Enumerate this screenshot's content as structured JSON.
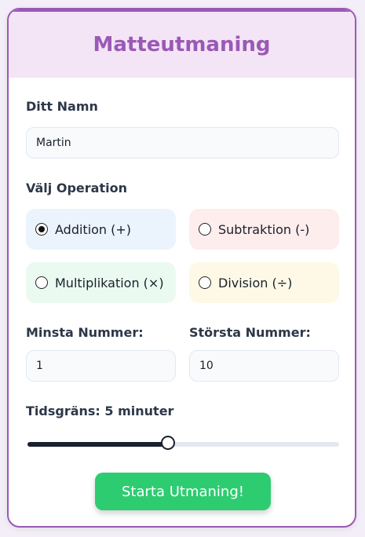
{
  "header": {
    "title": "Matteutmaning"
  },
  "name": {
    "label": "Ditt Namn",
    "value": "Martin"
  },
  "operation": {
    "label": "Välj Operation",
    "options": [
      {
        "label": "Addition (+)",
        "selected": true,
        "color": "#ebf3fc"
      },
      {
        "label": "Subtraktion (-)",
        "selected": false,
        "color": "#fdeded"
      },
      {
        "label": "Multiplikation (×)",
        "selected": false,
        "color": "#eafaf0"
      },
      {
        "label": "Division (÷)",
        "selected": false,
        "color": "#fef9e7"
      }
    ]
  },
  "min_number": {
    "label": "Minsta Nummer:",
    "value": "1"
  },
  "max_number": {
    "label": "Största Nummer:",
    "value": "10"
  },
  "time_limit": {
    "label": "Tidsgräns: 5 minuter",
    "fraction": 0.45
  },
  "start_button": {
    "label": "Starta Utmaning!"
  },
  "colors": {
    "accent": "#9b59b6",
    "header_bg": "#f3e5f5",
    "button": "#2ecc71"
  }
}
